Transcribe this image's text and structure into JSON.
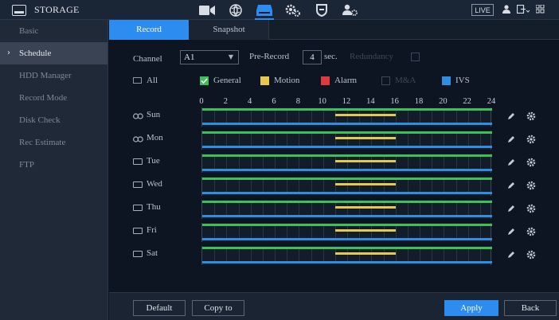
{
  "header": {
    "title": "STORAGE",
    "title_icon": "storage-icon",
    "nav_icons": [
      "camera-icon",
      "network-icon",
      "storage-icon",
      "system-settings-icon",
      "security-shield-icon",
      "account-icon"
    ],
    "active_nav": "storage-icon",
    "live_label": "LIVE",
    "right_icons": [
      "user-icon",
      "logout-icon",
      "grid-menu-icon"
    ]
  },
  "sidebar": {
    "items": [
      {
        "label": "Basic",
        "active": false
      },
      {
        "label": "Schedule",
        "active": true
      },
      {
        "label": "HDD Manager",
        "active": false
      },
      {
        "label": "Record Mode",
        "active": false
      },
      {
        "label": "Disk Check",
        "active": false
      },
      {
        "label": "Rec Estimate",
        "active": false
      },
      {
        "label": "FTP",
        "active": false
      }
    ]
  },
  "tabs": [
    {
      "label": "Record",
      "active": true
    },
    {
      "label": "Snapshot",
      "active": false
    }
  ],
  "form": {
    "channel_label": "Channel",
    "channel_value": "A1",
    "prerecord_label": "Pre-Record",
    "prerecord_value": "4",
    "sec_label": "sec.",
    "redundancy_label": "Redundancy"
  },
  "legend": {
    "all": "All",
    "general": "General",
    "motion": "Motion",
    "alarm": "Alarm",
    "mda": "M&A",
    "ivs": "IVS",
    "colors": {
      "general": "#3fbf5a",
      "motion": "#e6c84a",
      "alarm": "#e03a3a",
      "ivs": "#2f8ee0"
    }
  },
  "hours": [
    "0",
    "2",
    "4",
    "6",
    "8",
    "10",
    "12",
    "14",
    "16",
    "18",
    "20",
    "22",
    "24"
  ],
  "days": [
    {
      "label": "Sun",
      "linked": true
    },
    {
      "label": "Mon",
      "linked": true
    },
    {
      "label": "Tue",
      "linked": false
    },
    {
      "label": "Wed",
      "linked": false
    },
    {
      "label": "Thu",
      "linked": false
    },
    {
      "label": "Fri",
      "linked": false
    },
    {
      "label": "Sat",
      "linked": false
    }
  ],
  "schedule": {
    "general": [
      0,
      24
    ],
    "motion": [
      11,
      16
    ],
    "ivs": [
      0,
      24
    ]
  },
  "buttons": {
    "default": "Default",
    "copy_to": "Copy to",
    "apply": "Apply",
    "back": "Back"
  }
}
